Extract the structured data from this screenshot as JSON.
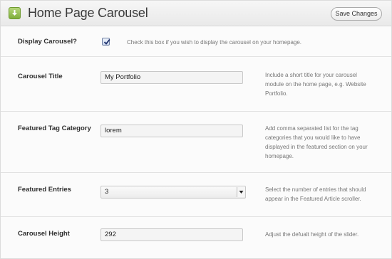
{
  "header": {
    "title": "Home Page Carousel",
    "save_label": "Save Changes"
  },
  "settings": {
    "display_carousel": {
      "label": "Display Carousel?",
      "checked": true,
      "description": "Check this box if you wish to display the carousel on your homepage."
    },
    "carousel_title": {
      "label": "Carousel Title",
      "value": "My Portfolio",
      "description": "Include a short title for your carousel module on the home page, e.g. Website Portfolio."
    },
    "featured_tag_category": {
      "label": "Featured Tag Category",
      "value": "lorem",
      "description": "Add comma separated list for the tag categories that you would like to have displayed in the featured section on your homepage."
    },
    "featured_entries": {
      "label": "Featured Entries",
      "value": "3",
      "description": "Select the number of entries that should appear in the Featured Article scroller."
    },
    "carousel_height": {
      "label": "Carousel Height",
      "value": "292",
      "description": "Adjust the defualt height of the slider."
    }
  },
  "colors": {
    "accent_green": "#7fae3c",
    "label_text": "#2e2e2e",
    "description_text": "#777777"
  },
  "icons": {
    "header_icon": "green-download-arrow-icon",
    "select_arrow": "chevron-down-icon",
    "checkbox_mark": "checkmark-icon"
  }
}
